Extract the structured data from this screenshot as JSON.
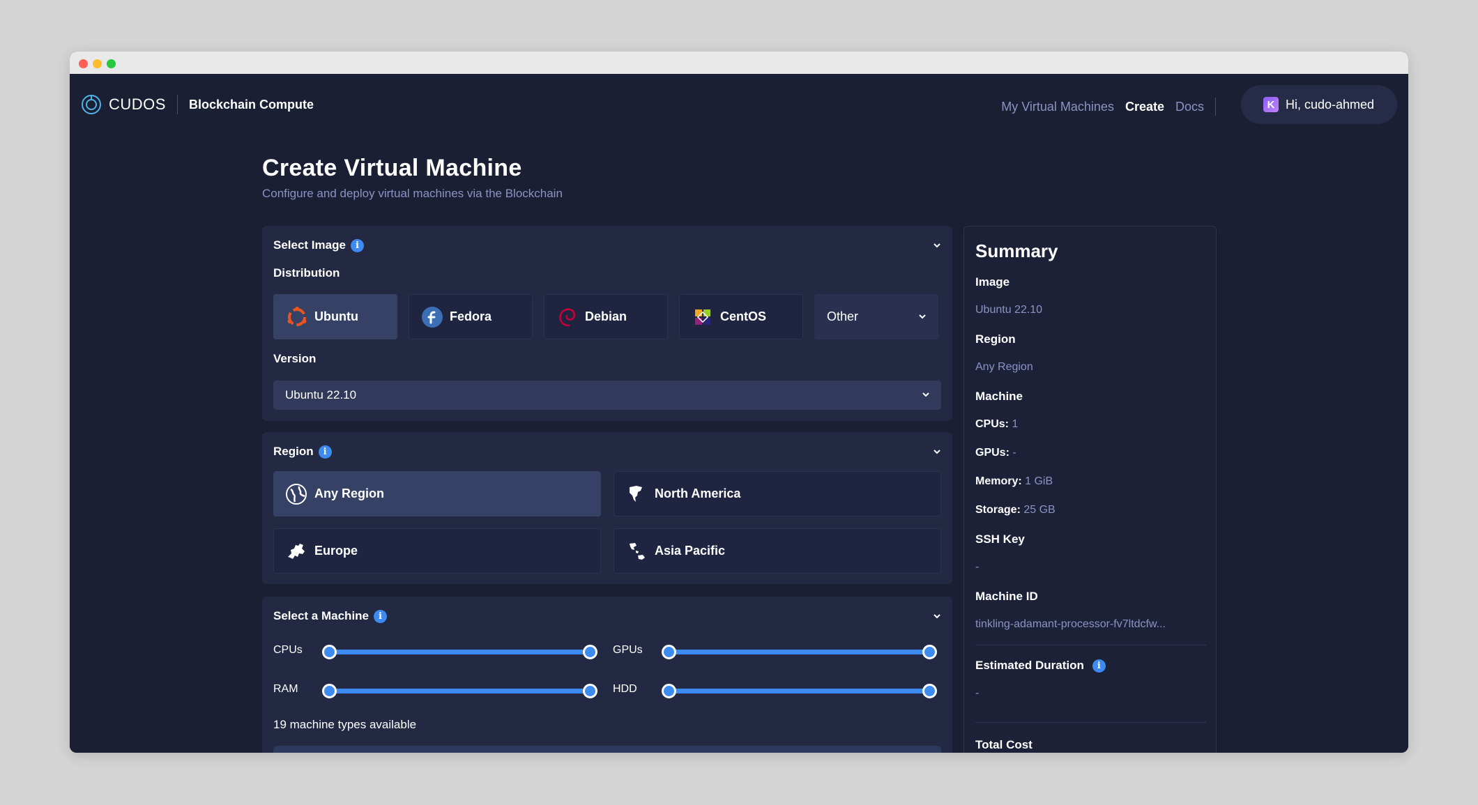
{
  "header": {
    "brand": "CUDOS",
    "product": "Blockchain Compute",
    "nav": [
      "My Virtual Machines",
      "Create",
      "Docs"
    ],
    "active_nav": "Create",
    "user_initial": "K",
    "user_greeting": "Hi, cudo-ahmed"
  },
  "page": {
    "title": "Create Virtual Machine",
    "subtitle": "Configure and deploy virtual machines via the Blockchain"
  },
  "image_section": {
    "title": "Select Image",
    "distribution_label": "Distribution",
    "distributions": [
      "Ubuntu",
      "Fedora",
      "Debian",
      "CentOS"
    ],
    "selected_distribution": "Ubuntu",
    "other_label": "Other",
    "version_label": "Version",
    "version_value": "Ubuntu 22.10"
  },
  "region_section": {
    "title": "Region",
    "regions": [
      "Any Region",
      "North America",
      "Europe",
      "Asia Pacific"
    ],
    "selected_region": "Any Region"
  },
  "machine_section": {
    "title": "Select a Machine",
    "sliders": [
      {
        "label": "CPUs",
        "low": 0,
        "high": 1
      },
      {
        "label": "GPUs",
        "low": 0,
        "high": 1
      },
      {
        "label": "RAM",
        "low": 0,
        "high": 1
      },
      {
        "label": "HDD",
        "low": 0,
        "high": 1
      }
    ],
    "available_text": "19 machine types available"
  },
  "summary": {
    "title": "Summary",
    "image_label": "Image",
    "image_value": "Ubuntu 22.10",
    "region_label": "Region",
    "region_value": "Any Region",
    "machine_label": "Machine",
    "cpus_key": "CPUs:",
    "cpus_value": "1",
    "gpus_key": "GPUs:",
    "gpus_value": "-",
    "memory_key": "Memory:",
    "memory_value": "1 GiB",
    "storage_key": "Storage:",
    "storage_value": "25 GB",
    "ssh_label": "SSH Key",
    "ssh_value": "-",
    "machine_id_label": "Machine ID",
    "machine_id_value": "tinkling-adamant-processor-fv7ltdcfw...",
    "duration_label": "Estimated Duration",
    "duration_value": "-",
    "total_cost_label": "Total Cost"
  },
  "colors": {
    "background": "#1b1f33",
    "panel": "#232942",
    "selected": "#354266",
    "accent": "#3d8bf0",
    "muted_text": "#8a93c4"
  }
}
